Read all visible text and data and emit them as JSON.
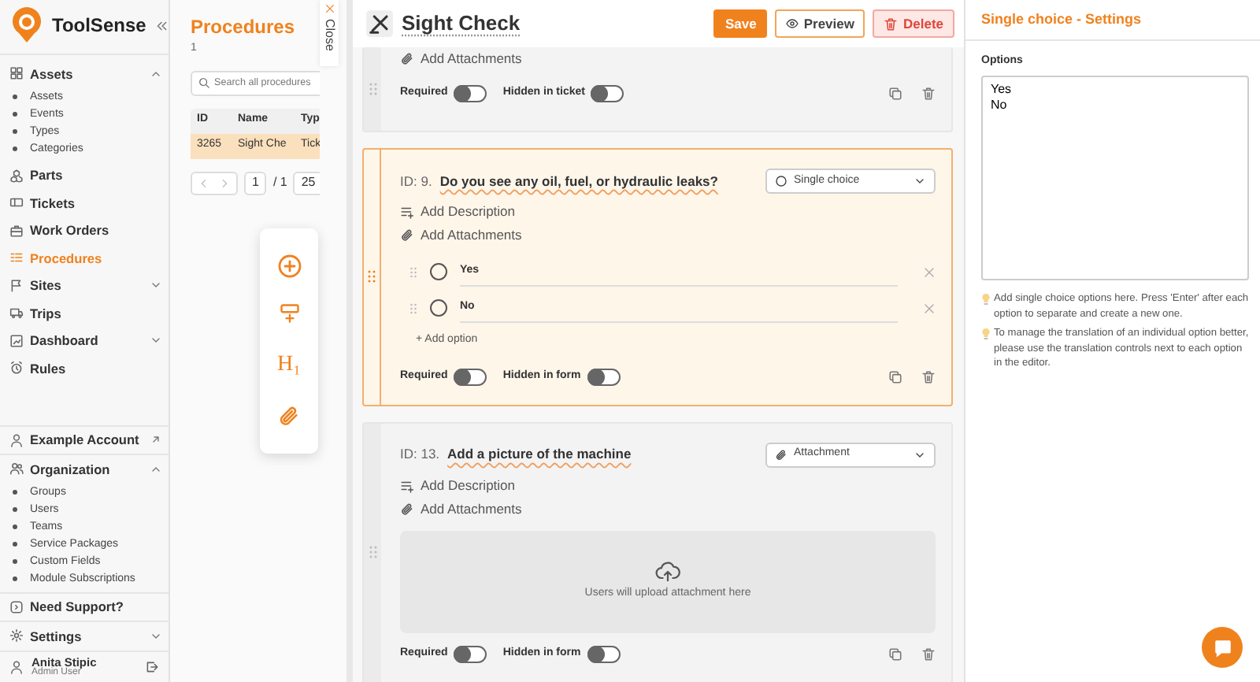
{
  "sidebar": {
    "brand": "ToolSense",
    "nav": [
      {
        "label": "Assets",
        "kind": "group",
        "expanded": true,
        "selected": false,
        "children": [
          {
            "label": "Assets"
          },
          {
            "label": "Events"
          },
          {
            "label": "Types"
          },
          {
            "label": "Categories"
          }
        ]
      },
      {
        "label": "Parts",
        "kind": "link",
        "selected": false
      },
      {
        "label": "Tickets",
        "kind": "link",
        "selected": false
      },
      {
        "label": "Work Orders",
        "kind": "link",
        "selected": false
      },
      {
        "label": "Procedures",
        "kind": "link",
        "selected": true
      },
      {
        "label": "Sites",
        "kind": "group",
        "expanded": false,
        "selected": false
      },
      {
        "label": "Trips",
        "kind": "link",
        "selected": false
      },
      {
        "label": "Dashboard",
        "kind": "group",
        "expanded": false,
        "selected": false
      },
      {
        "label": "Rules",
        "kind": "link",
        "selected": false
      }
    ],
    "bottom": [
      {
        "label": "Example Account",
        "kind": "external",
        "selected": false
      },
      {
        "label": "Organization",
        "kind": "group",
        "expanded": true,
        "selected": false,
        "children": [
          {
            "label": "Groups"
          },
          {
            "label": "Users"
          },
          {
            "label": "Teams"
          },
          {
            "label": "Service Packages"
          },
          {
            "label": "Custom Fields"
          },
          {
            "label": "Module Subscriptions"
          }
        ]
      },
      {
        "label": "Need Support?",
        "kind": "link",
        "selected": false
      },
      {
        "label": "Settings",
        "kind": "group",
        "expanded": false,
        "selected": false
      }
    ],
    "user": {
      "name": "Anita Stipic",
      "role": "Admin User"
    }
  },
  "list_panel": {
    "title": "Procedures",
    "count": "1",
    "search": {
      "placeholder": "Search all procedures"
    },
    "columns": [
      "ID",
      "Name",
      "Typ"
    ],
    "rows": [
      {
        "cells": [
          "3265",
          "Sight Che",
          "Tick"
        ],
        "selected": true
      }
    ],
    "pager": {
      "page": "1",
      "total": "/ 1",
      "page_size": "25"
    }
  },
  "close_tab": {
    "label": "Close"
  },
  "toolbar": {
    "heading_glyph": "H₁"
  },
  "editor": {
    "title": "Sight Check",
    "buttons": [
      {
        "label": "Save",
        "kind": "primary"
      },
      {
        "label": "Preview",
        "kind": "preview"
      },
      {
        "label": "Delete",
        "kind": "danger"
      }
    ],
    "questions": [
      {
        "selected": false,
        "actions": [
          {
            "kind": "attachments",
            "label": "Add Attachments"
          }
        ],
        "toggles": [
          {
            "label": "Required",
            "on": false
          },
          {
            "label": "Hidden in ticket",
            "on": false
          }
        ]
      },
      {
        "selected": true,
        "id_label": "ID: 9.",
        "title": "Do you see any oil, fuel, or hydraulic leaks?",
        "type": {
          "kind": "single",
          "label": "Single choice"
        },
        "actions": [
          {
            "kind": "description",
            "label": "Add Description"
          },
          {
            "kind": "attachments",
            "label": "Add Attachments"
          }
        ],
        "options": [
          {
            "label": "Yes"
          },
          {
            "label": "No"
          }
        ],
        "add_option": "+ Add option",
        "toggles": [
          {
            "label": "Required",
            "on": false
          },
          {
            "label": "Hidden in form",
            "on": false
          }
        ]
      },
      {
        "selected": false,
        "id_label": "ID: 13.",
        "title": "Add a picture of the machine",
        "type": {
          "kind": "attachment",
          "label": "Attachment"
        },
        "actions": [
          {
            "kind": "description",
            "label": "Add Description"
          },
          {
            "kind": "attachments",
            "label": "Add Attachments"
          }
        ],
        "upload": "Users will upload attachment here",
        "toggles": [
          {
            "label": "Required",
            "on": false
          },
          {
            "label": "Hidden in form",
            "on": false
          }
        ]
      }
    ]
  },
  "settings": {
    "title": "Single choice - Settings",
    "options_label": "Options",
    "options_value": "Yes\nNo",
    "hints": [
      "Add single choice options here. Press 'Enter' after each option to separate and create a new one.",
      "To manage the translation of an individual option better, please use the translation controls next to each option in the editor."
    ]
  }
}
